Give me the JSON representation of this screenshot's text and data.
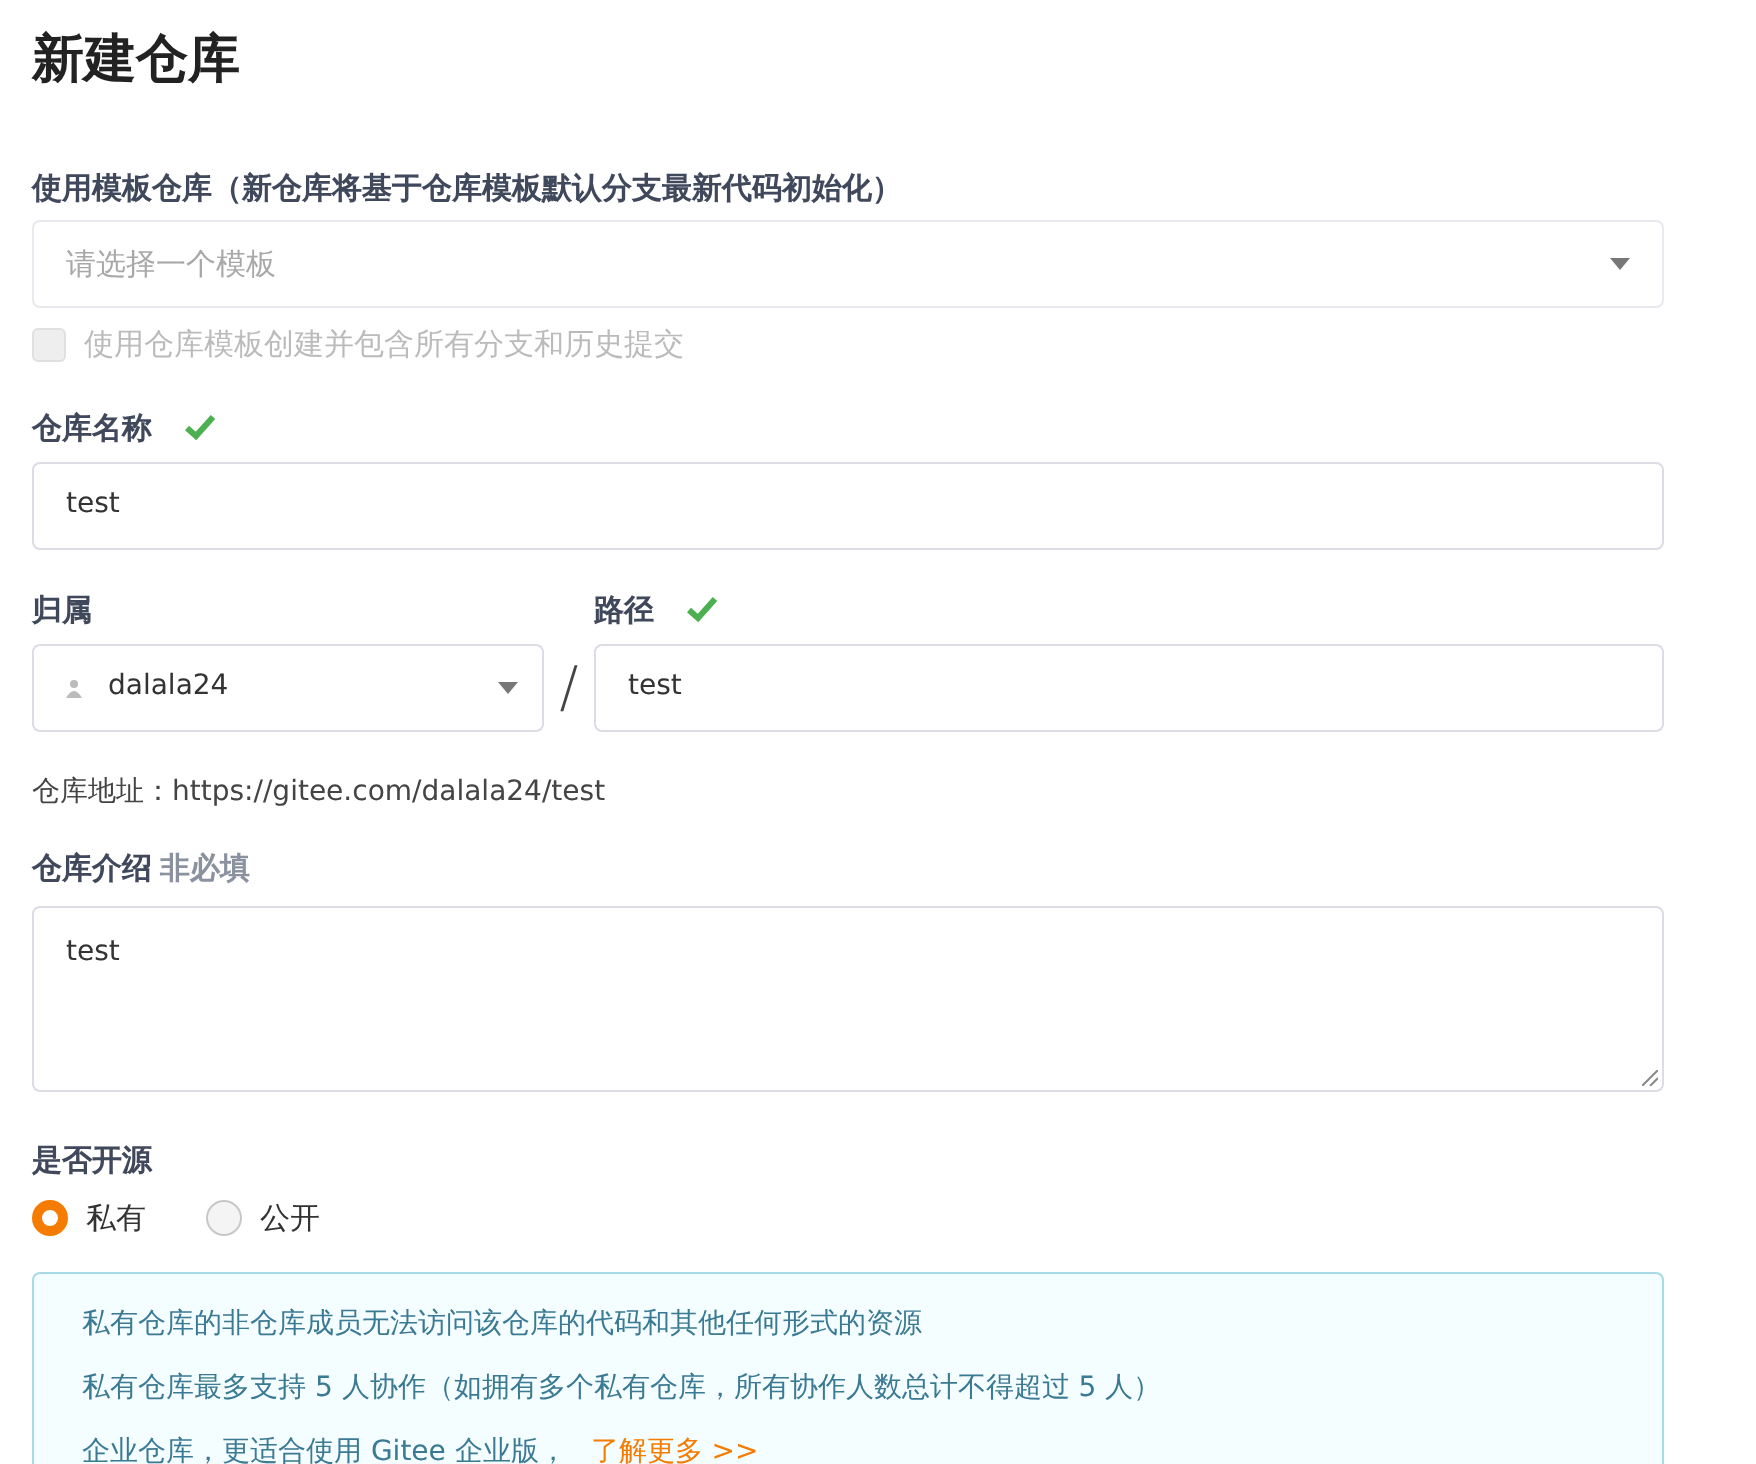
{
  "title": "新建仓库",
  "template": {
    "label": "使用模板仓库（新仓库将基于仓库模板默认分支最新代码初始化）",
    "placeholder": "请选择一个模板",
    "include_all": {
      "label": "使用仓库模板创建并包含所有分支和历史提交",
      "checked": false,
      "disabled": true
    }
  },
  "repo_name": {
    "label": "仓库名称",
    "valid": true,
    "value": "test"
  },
  "owner": {
    "label": "归属",
    "value": "dalala24"
  },
  "separator": "/",
  "path": {
    "label": "路径",
    "valid": true,
    "value": "test"
  },
  "repo_address": "仓库地址：https://gitee.com/dalala24/test",
  "description": {
    "label": "仓库介绍",
    "hint": "非必填",
    "value": "test"
  },
  "visibility": {
    "label": "是否开源",
    "options": [
      {
        "label": "私有",
        "selected": true
      },
      {
        "label": "公开",
        "selected": false
      }
    ]
  },
  "info": {
    "lines": [
      "私有仓库的非仓库成员无法访问该仓库的代码和其他任何形式的资源",
      "私有仓库最多支持 5 人协作（如拥有多个私有仓库，所有协作人数总计不得超过 5 人）",
      "企业仓库，更适合使用 Gitee 企业版，"
    ],
    "link": "了解更多 >>"
  }
}
